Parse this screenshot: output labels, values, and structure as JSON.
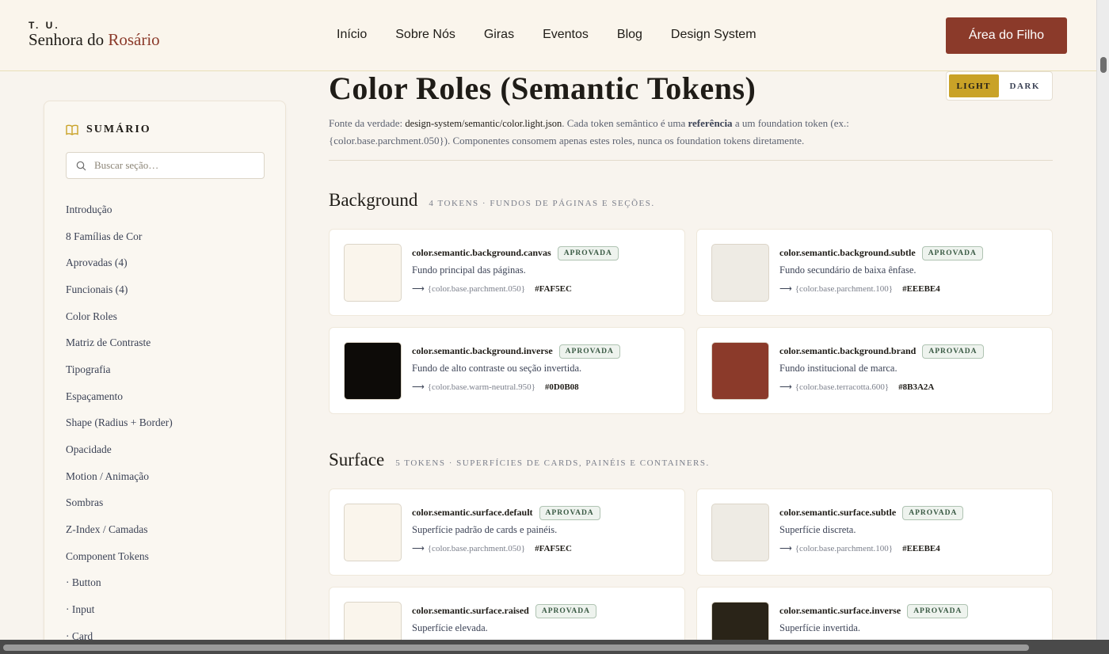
{
  "header": {
    "logo_top": "T. U.",
    "logo_main": "Senhora do ",
    "logo_accent": "Rosário",
    "nav": [
      "Início",
      "Sobre Nós",
      "Giras",
      "Eventos",
      "Blog",
      "Design System"
    ],
    "cta": "Área do Filho"
  },
  "sidebar": {
    "title": "SUMÁRIO",
    "search_placeholder": "Buscar seção…",
    "items": [
      "Introdução",
      "8 Famílias de Cor",
      "Aprovadas (4)",
      "Funcionais (4)",
      "Color Roles",
      "Matriz de Contraste",
      "Tipografia",
      "Espaçamento",
      "Shape (Radius + Border)",
      "Opacidade",
      "Motion / Animação",
      "Sombras",
      "Z-Index / Camadas",
      "Component Tokens",
      "· Button",
      "· Input",
      "· Card"
    ]
  },
  "main": {
    "title": "Color Roles (Semantic Tokens)",
    "toggle": {
      "light": "LIGHT",
      "dark": "DARK"
    },
    "intro": {
      "p1": "Fonte da verdade: ",
      "code": "design-system/semantic/color.light.json",
      "p2": ". Cada token semântico é uma ",
      "bold": "referência",
      "p3": " a um foundation token (ex.: {color.base.parchment.050}). Componentes consomem apenas estes roles, nunca os foundation tokens diretamente."
    },
    "sections": [
      {
        "title": "Background",
        "meta": "4 TOKENS · FUNDOS DE PÁGINAS E SEÇÕES.",
        "tokens": [
          {
            "name": "color.semantic.background.canvas",
            "badge": "APROVADA",
            "desc": "Fundo principal das páginas.",
            "ref": "{color.base.parchment.050}",
            "hex": "#FAF5EC",
            "color": "#FAF5EC"
          },
          {
            "name": "color.semantic.background.subtle",
            "badge": "APROVADA",
            "desc": "Fundo secundário de baixa ênfase.",
            "ref": "{color.base.parchment.100}",
            "hex": "#EEEBE4",
            "color": "#EEEBE4"
          },
          {
            "name": "color.semantic.background.inverse",
            "badge": "APROVADA",
            "desc": "Fundo de alto contraste ou seção invertida.",
            "ref": "{color.base.warm-neutral.950}",
            "hex": "#0D0B08",
            "color": "#0D0B08"
          },
          {
            "name": "color.semantic.background.brand",
            "badge": "APROVADA",
            "desc": "Fundo institucional de marca.",
            "ref": "{color.base.terracotta.600}",
            "hex": "#8B3A2A",
            "color": "#8B3A2A"
          }
        ]
      },
      {
        "title": "Surface",
        "meta": "5 TOKENS · SUPERFÍCIES DE CARDS, PAINÉIS E CONTAINERS.",
        "tokens": [
          {
            "name": "color.semantic.surface.default",
            "badge": "APROVADA",
            "desc": "Superfície padrão de cards e painéis.",
            "ref": "{color.base.parchment.050}",
            "hex": "#FAF5EC",
            "color": "#FAF5EC"
          },
          {
            "name": "color.semantic.surface.subtle",
            "badge": "APROVADA",
            "desc": "Superfície discreta.",
            "ref": "{color.base.parchment.100}",
            "hex": "#EEEBE4",
            "color": "#EEEBE4"
          },
          {
            "name": "color.semantic.surface.raised",
            "badge": "APROVADA",
            "desc": "Superfície elevada.",
            "ref": "",
            "hex": "",
            "color": "#FAF5EC"
          },
          {
            "name": "color.semantic.surface.inverse",
            "badge": "APROVADA",
            "desc": "Superfície invertida.",
            "ref": "",
            "hex": "",
            "color": "#2A2418"
          }
        ]
      }
    ]
  },
  "arrow_glyph": "⟶"
}
